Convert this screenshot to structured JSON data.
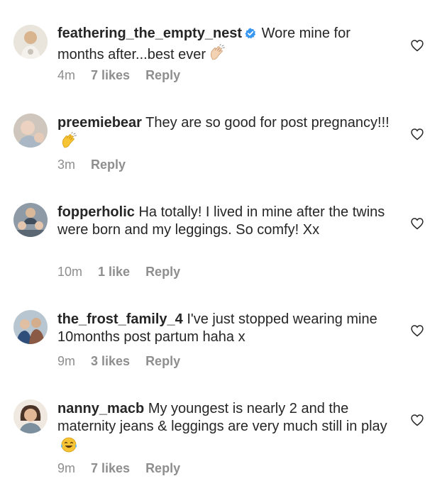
{
  "comments": [
    {
      "username": "feathering_the_empty_nest",
      "verified": true,
      "text": "Wore mine for months after...best ever",
      "emoji": "clapping-hands-light",
      "time": "4m",
      "likes": "7 likes",
      "reply": "Reply"
    },
    {
      "username": "preemiebear",
      "verified": false,
      "text": "They are so good for post pregnancy!!!",
      "emoji": "clapping-hands",
      "time": "3m",
      "likes": "",
      "reply": "Reply"
    },
    {
      "username": "fopperholic",
      "verified": false,
      "text": "Ha totally! I lived in mine after the twins were born and my leggings. So comfy! Xx",
      "emoji": "",
      "time": "10m",
      "likes": "1 like",
      "reply": "Reply"
    },
    {
      "username": "the_frost_family_4",
      "verified": false,
      "text": "I've just stopped wearing mine 10months post partum haha x",
      "emoji": "",
      "time": "9m",
      "likes": "3 likes",
      "reply": "Reply"
    },
    {
      "username": "nanny_macb",
      "verified": false,
      "text": "My youngest is nearly 2 and the maternity jeans & leggings are very much still in play",
      "emoji": "tears-of-joy",
      "time": "9m",
      "likes": "7 likes",
      "reply": "Reply"
    }
  ],
  "colors": {
    "text": "#262626",
    "meta": "#8e8e8e",
    "verified": "#3897f0"
  }
}
